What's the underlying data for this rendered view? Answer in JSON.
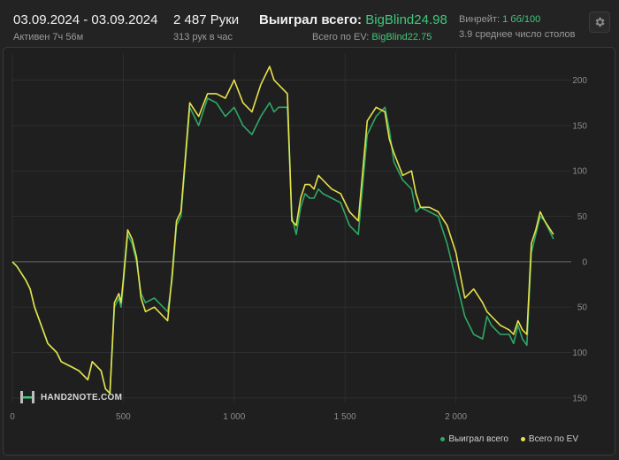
{
  "header": {
    "date_range": "03.09.2024 - 03.09.2024",
    "active_time": "Активен 7ч 56м",
    "hands": "2 487 Руки",
    "hands_per_hour": "313 рук в час",
    "won_total_label": "Выиграл всего:",
    "won_total_value": "BigBlind24.98",
    "ev_total_label": "Всего по EV:",
    "ev_total_value": "BigBlind22.75",
    "winrate_label": "Винрейт:",
    "winrate_value": "1 бб/100",
    "avg_tables": "3.9 среднее число столов"
  },
  "logo_text": "HAND2NOTE.COM",
  "colors": {
    "won": "#2fa866",
    "ev": "#e6e24a",
    "accent": "#3ec97a",
    "background": "#232323"
  },
  "icons": {
    "settings": "gear-icon",
    "logo": "h2n-logo-icon"
  },
  "chart_data": {
    "type": "line",
    "xlabel": "",
    "ylabel": "",
    "xlim": [
      0,
      2520
    ],
    "ylim": [
      -155,
      220
    ],
    "x_ticks": [
      0,
      500,
      1000,
      1500,
      2000
    ],
    "x_tick_labels": [
      "0",
      "500",
      "1 000",
      "1 500",
      "2 000"
    ],
    "y_ticks": [
      200,
      150,
      100,
      50,
      0,
      -50,
      -100,
      -150
    ],
    "y_tick_labels": [
      "200",
      "150",
      "100",
      "50",
      "0",
      "50",
      "100",
      "150"
    ],
    "y_axis_side": "right",
    "grid": true,
    "legend_position": "bottom-right",
    "series": [
      {
        "name": "Выиграл всего",
        "color": "#2fa866",
        "x": [
          0,
          20,
          60,
          80,
          100,
          130,
          160,
          200,
          220,
          260,
          300,
          340,
          360,
          400,
          420,
          440,
          460,
          480,
          490,
          500,
          520,
          540,
          560,
          580,
          600,
          640,
          680,
          700,
          720,
          740,
          760,
          800,
          840,
          880,
          920,
          960,
          1000,
          1040,
          1080,
          1120,
          1160,
          1180,
          1200,
          1240,
          1260,
          1280,
          1300,
          1320,
          1340,
          1360,
          1380,
          1400,
          1440,
          1480,
          1520,
          1560,
          1600,
          1640,
          1680,
          1700,
          1720,
          1760,
          1800,
          1820,
          1840,
          1880,
          1920,
          1960,
          2000,
          2040,
          2080,
          2120,
          2140,
          2160,
          2200,
          2240,
          2260,
          2280,
          2300,
          2320,
          2340,
          2360,
          2380,
          2400,
          2440
        ],
        "values": [
          0,
          -5,
          -20,
          -30,
          -50,
          -70,
          -90,
          -100,
          -110,
          -115,
          -120,
          -130,
          -110,
          -120,
          -140,
          -145,
          -50,
          -40,
          -50,
          -25,
          30,
          20,
          0,
          -35,
          -45,
          -40,
          -50,
          -55,
          -20,
          40,
          50,
          170,
          150,
          180,
          175,
          160,
          170,
          150,
          140,
          160,
          175,
          165,
          170,
          170,
          50,
          30,
          60,
          75,
          70,
          70,
          80,
          75,
          70,
          65,
          40,
          30,
          140,
          160,
          170,
          145,
          110,
          90,
          80,
          55,
          60,
          55,
          50,
          20,
          -20,
          -60,
          -80,
          -85,
          -60,
          -70,
          -80,
          -80,
          -90,
          -70,
          -85,
          -92,
          10,
          30,
          50,
          45,
          25
        ]
      },
      {
        "name": "Всего по EV",
        "color": "#e6e24a",
        "x": [
          0,
          20,
          60,
          80,
          100,
          130,
          160,
          200,
          220,
          260,
          300,
          340,
          360,
          400,
          420,
          440,
          460,
          480,
          490,
          500,
          520,
          540,
          560,
          580,
          600,
          640,
          680,
          700,
          720,
          740,
          760,
          800,
          840,
          880,
          920,
          960,
          1000,
          1040,
          1080,
          1120,
          1160,
          1180,
          1200,
          1240,
          1260,
          1280,
          1300,
          1320,
          1340,
          1360,
          1380,
          1400,
          1440,
          1480,
          1520,
          1560,
          1600,
          1640,
          1680,
          1700,
          1720,
          1760,
          1800,
          1820,
          1840,
          1880,
          1920,
          1960,
          2000,
          2040,
          2080,
          2120,
          2140,
          2160,
          2200,
          2240,
          2260,
          2280,
          2300,
          2320,
          2340,
          2360,
          2380,
          2400,
          2440
        ],
        "values": [
          0,
          -5,
          -20,
          -30,
          -50,
          -70,
          -90,
          -100,
          -110,
          -115,
          -120,
          -130,
          -110,
          -120,
          -140,
          -145,
          -45,
          -35,
          -45,
          -20,
          35,
          25,
          5,
          -40,
          -55,
          -50,
          -60,
          -65,
          -15,
          45,
          55,
          175,
          160,
          185,
          185,
          180,
          200,
          175,
          165,
          195,
          215,
          200,
          195,
          185,
          45,
          40,
          70,
          85,
          85,
          80,
          95,
          90,
          80,
          75,
          55,
          45,
          155,
          170,
          165,
          135,
          120,
          95,
          100,
          75,
          60,
          60,
          55,
          40,
          10,
          -40,
          -30,
          -45,
          -55,
          -60,
          -70,
          -75,
          -80,
          -65,
          -75,
          -80,
          20,
          35,
          55,
          45,
          30
        ]
      }
    ]
  },
  "legend": {
    "won_label": "Выиграл всего",
    "ev_label": "Всего по EV"
  }
}
